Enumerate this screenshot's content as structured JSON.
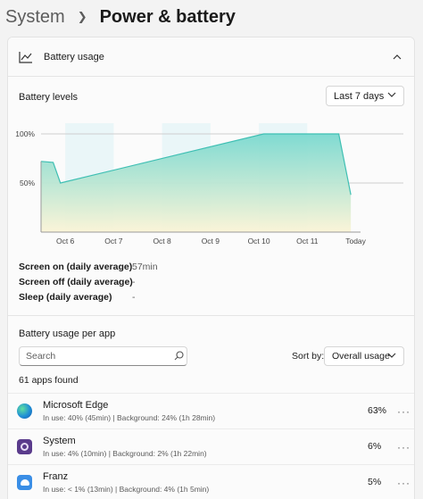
{
  "breadcrumb": {
    "parent": "System",
    "current": "Power & battery"
  },
  "battery_usage": {
    "title": "Battery usage",
    "levels_title": "Battery levels",
    "range": "Last 7 days",
    "stats": [
      {
        "label": "Screen on (daily average)",
        "value": "57min"
      },
      {
        "label": "Screen off (daily average)",
        "value": "-"
      },
      {
        "label": "Sleep (daily average)",
        "value": "-"
      }
    ],
    "per_app_title": "Battery usage per app",
    "search_placeholder": "Search",
    "sort_label": "Sort by:",
    "sort_value": "Overall usage",
    "apps_found": "61 apps found",
    "apps": [
      {
        "name": "Microsoft Edge",
        "detail": "In use: 40% (45min) | Background: 24% (1h 28min)",
        "percent": "63%",
        "icon": "edge-icon",
        "color": "#1f8fd6"
      },
      {
        "name": "System",
        "detail": "In use: 4% (10min) | Background: 2% (1h 22min)",
        "percent": "6%",
        "icon": "system-icon",
        "color": "#6b3fa0"
      },
      {
        "name": "Franz",
        "detail": "In use: < 1% (13min) | Background: 4% (1h 5min)",
        "percent": "5%",
        "icon": "franz-icon",
        "color": "#3a8ee6"
      }
    ]
  },
  "chart_data": {
    "type": "area",
    "x": [
      "Oct 6",
      "Oct 7",
      "Oct 8",
      "Oct 9",
      "Oct 10",
      "Oct 11",
      "Today"
    ],
    "y_ticks": [
      "100%",
      "50%"
    ],
    "ylim": [
      0,
      100
    ],
    "xlim": [
      0,
      6.6
    ],
    "grid": true,
    "points": [
      [
        0,
        72
      ],
      [
        0.25,
        71
      ],
      [
        0.4,
        50
      ],
      [
        4.6,
        100
      ],
      [
        6.15,
        100
      ],
      [
        6.4,
        38
      ]
    ],
    "colors": {
      "fill_top": "#7ad9d0",
      "fill_bottom": "#fbf4d6",
      "line": "#3fbfb3",
      "band": "#eaf6f8"
    }
  }
}
